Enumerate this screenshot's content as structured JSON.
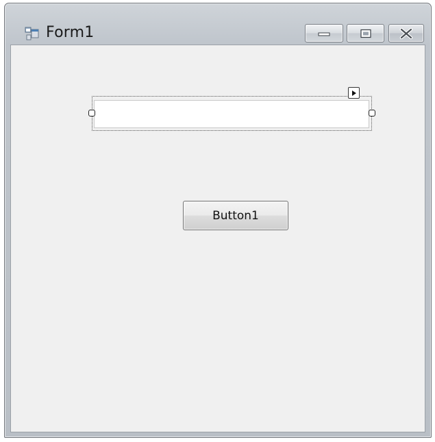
{
  "window": {
    "title": "Form1",
    "icon": "form-icon",
    "caption_buttons": {
      "minimize_icon": "minimize-icon",
      "maximize_icon": "maximize-icon",
      "close_icon": "close-icon"
    }
  },
  "form": {
    "textbox": {
      "value": "",
      "selected_in_designer": true
    },
    "button": {
      "label": "Button1"
    }
  },
  "colors": {
    "client_background": "#f0f0f0",
    "frame": "#c4c9cf"
  }
}
